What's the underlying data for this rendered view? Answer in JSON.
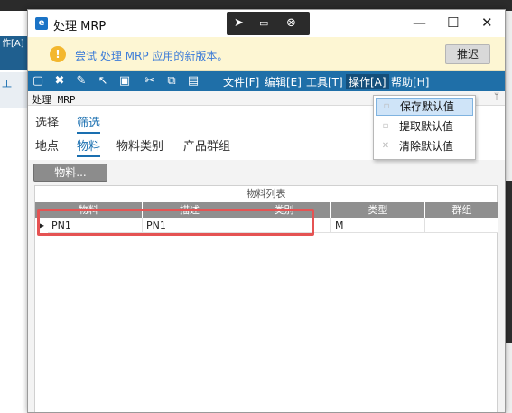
{
  "window": {
    "title": "处理 MRP",
    "app_icon": "e"
  },
  "background": {
    "left_strip_text": "作[A]",
    "left_tab_text": "工"
  },
  "notice": {
    "link_text": "尝试 处理 MRP 应用的新版本。",
    "dismiss_label": "推迟"
  },
  "toolbar": {
    "menus": [
      "文件[F]",
      "编辑[E]",
      "工具[T]",
      "操作[A]",
      "帮助[H]"
    ]
  },
  "panel": {
    "title": "处理 MRP"
  },
  "tabs_primary": [
    "选择",
    "筛选"
  ],
  "tabs_secondary": [
    "地点",
    "物料",
    "物料类别",
    "产品群组"
  ],
  "content": {
    "material_button": "物料..."
  },
  "grid": {
    "caption": "物料列表",
    "columns": [
      "物料",
      "描述",
      "类别",
      "类型",
      "群组"
    ],
    "rows": [
      {
        "material": "PN1",
        "description": "PN1",
        "category": "",
        "type": "M",
        "group": ""
      }
    ]
  },
  "dropdown": {
    "items": [
      "保存默认值",
      "提取默认值",
      "清除默认值"
    ]
  },
  "colors": {
    "accent": "#1f6fa8",
    "highlight": "#e55353"
  }
}
